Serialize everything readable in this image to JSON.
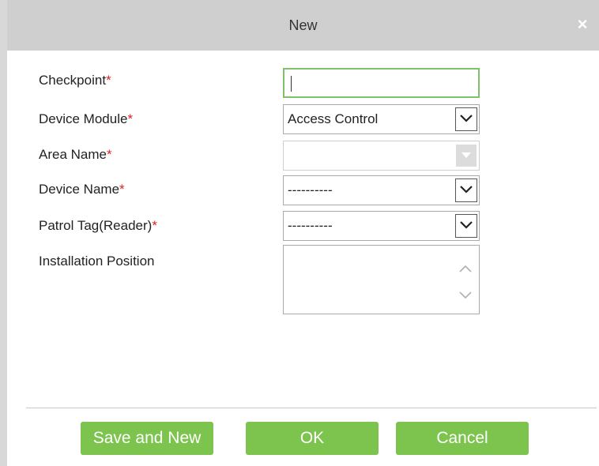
{
  "dialog": {
    "title": "New",
    "close_glyph": "×"
  },
  "form": {
    "checkpoint": {
      "label": "Checkpoint",
      "required_mark": "*",
      "value": ""
    },
    "device_module": {
      "label": "Device Module",
      "required_mark": "*",
      "value": "Access Control"
    },
    "area_name": {
      "label": "Area Name",
      "required_mark": "*",
      "value": ""
    },
    "device_name": {
      "label": "Device Name",
      "required_mark": "*",
      "value": "----------"
    },
    "patrol_tag": {
      "label": "Patrol Tag(Reader)",
      "required_mark": "*",
      "value": "----------"
    },
    "installation_position": {
      "label": "Installation Position",
      "value": ""
    }
  },
  "buttons": {
    "save_and_new": "Save and New",
    "ok": "OK",
    "cancel": "Cancel"
  },
  "colors": {
    "button_green": "#7dc44e",
    "required_red": "#e02020",
    "titlebar_gray": "#cfcfcf",
    "focus_green": "#7ec36a"
  },
  "icons": {
    "close": "close-icon",
    "dropdown": "chevron-down-icon",
    "scroll_up": "chevron-up-icon",
    "scroll_down": "chevron-down-icon"
  }
}
